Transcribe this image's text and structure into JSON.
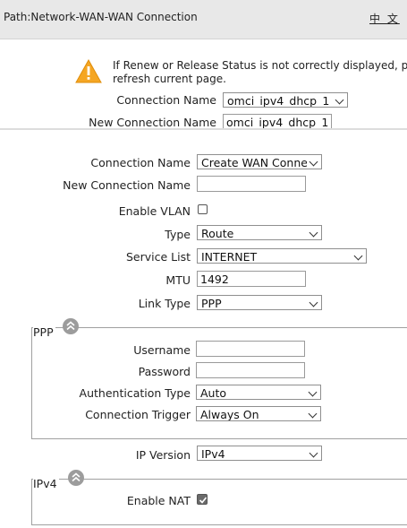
{
  "header": {
    "path_label": "Path:",
    "path": "Network-WAN-WAN Connection",
    "language_link": "中 文"
  },
  "notice": {
    "icon": "warning-icon",
    "line1": "If Renew or Release Status is not correctly displayed, p",
    "line2": "refresh current page."
  },
  "old_form": {
    "connection_name_label": "Connection Name",
    "connection_name_value": "omci_ipv4_dhcp_1",
    "new_connection_name_label": "New Connection Name",
    "new_connection_name_value": "omci_ipv4_dhcp_1"
  },
  "form": {
    "connection_name_label": "Connection Name",
    "connection_name_value": "Create WAN Connec",
    "new_connection_name_label": "New Connection Name",
    "new_connection_name_value": "",
    "enable_vlan_label": "Enable VLAN",
    "enable_vlan_checked": false,
    "type_label": "Type",
    "type_value": "Route",
    "service_list_label": "Service List",
    "service_list_value": "INTERNET",
    "mtu_label": "MTU",
    "mtu_value": "1492",
    "link_type_label": "Link Type",
    "link_type_value": "PPP"
  },
  "ppp": {
    "title": "PPP",
    "username_label": "Username",
    "username_value": "",
    "password_label": "Password",
    "password_value": "",
    "auth_type_label": "Authentication Type",
    "auth_type_value": "Auto",
    "trigger_label": "Connection Trigger",
    "trigger_value": "Always On"
  },
  "ip": {
    "ip_version_label": "IP Version",
    "ip_version_value": "IPv4"
  },
  "ipv4": {
    "title": "IPv4",
    "enable_nat_label": "Enable NAT",
    "enable_nat_checked": true
  },
  "colors": {
    "path_bar": "#e8e8e8",
    "warning": "#f5a623",
    "collapse_button": "#9c9c9c"
  }
}
